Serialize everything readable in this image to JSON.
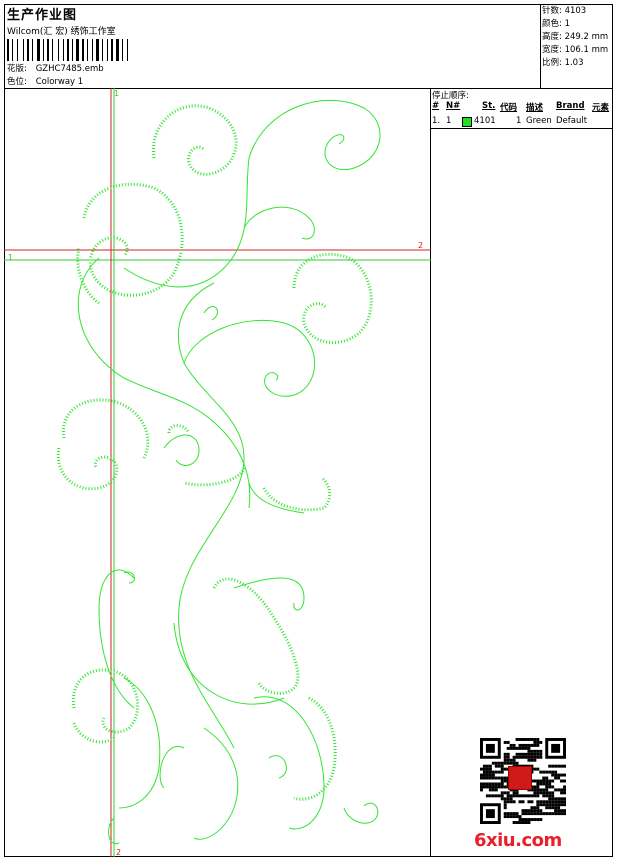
{
  "header": {
    "title": "生产作业图",
    "studio": "Wilcom(汇 宏) 绣饰工作室",
    "design_label": "花版:",
    "design_value": "GZHC7485.emb",
    "colorway_label": "色位:",
    "colorway_value": "Colorway 1"
  },
  "stats": {
    "stitches": "针数: 4103",
    "colors": "颜色: 1",
    "height": "高度: 249.2 mm",
    "width": "宽度: 106.1 mm",
    "scale": "比例: 1.03"
  },
  "canvas": {
    "guide_top_label": "1",
    "guide_left_label": "1",
    "guide_right_label": "2",
    "guide_bottom_label": "2",
    "thread_color": "#33e533",
    "guide_red": "#d42020",
    "guide_green": "#33cc33"
  },
  "stop_sequence": {
    "title": "停止顺序:",
    "columns": [
      "#",
      "N#",
      "St.",
      "代码",
      "描述",
      "Brand",
      "元素"
    ],
    "rows": [
      {
        "idx": "1.",
        "n": "1",
        "swatch": "#22dd22",
        "code": "4101",
        "st": "1",
        "desc": "Green",
        "brand": "Default"
      }
    ]
  },
  "watermark": "6xiu.com"
}
